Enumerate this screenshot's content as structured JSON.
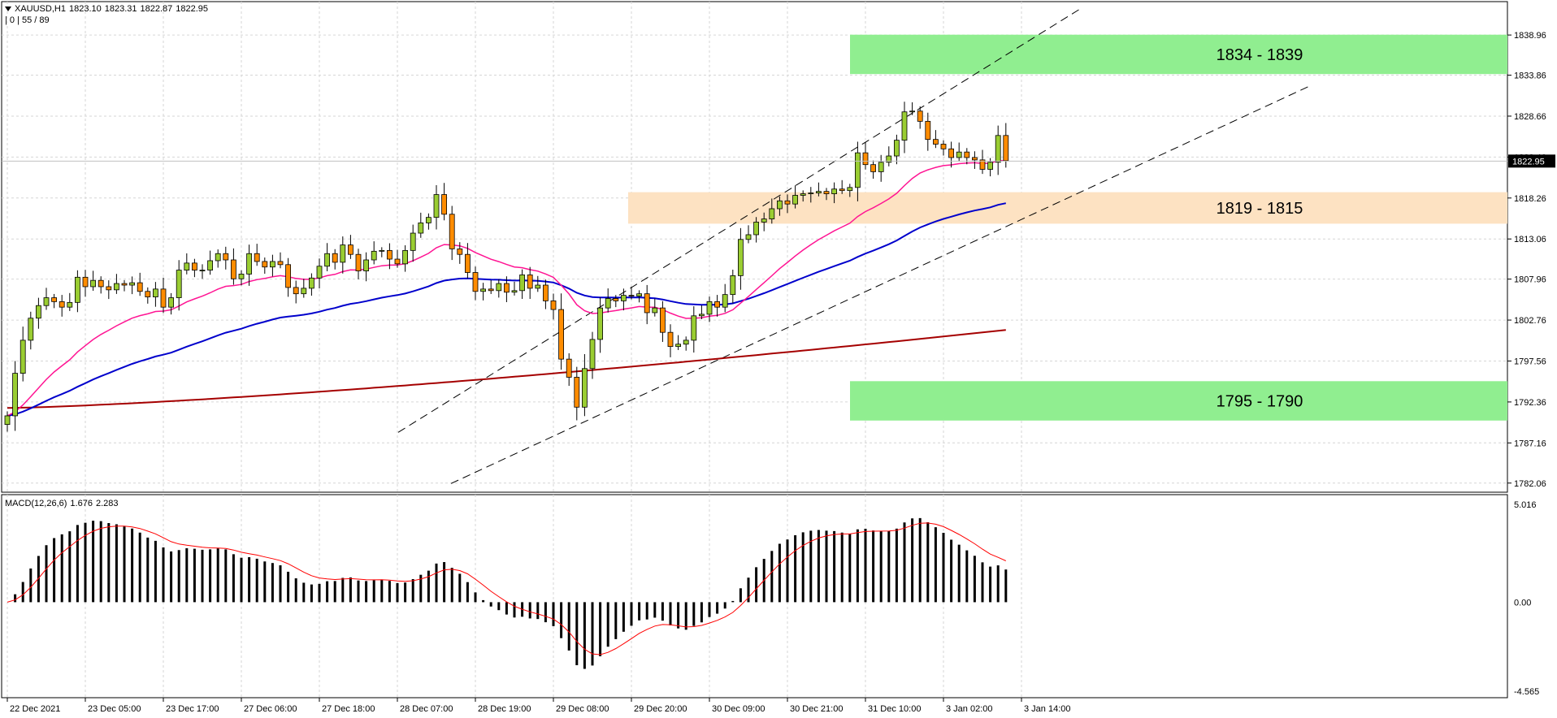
{
  "header": {
    "symbol": "XAUUSD,H1",
    "o": "1823.10",
    "h": "1823.31",
    "l": "1822.87",
    "c": "1822.95",
    "info": "| 0 | 55 / 89"
  },
  "macd_header": {
    "label": "MACD(12,26,6)",
    "v1": "1.676",
    "v2": "2.283"
  },
  "chart_data": [
    {
      "type": "candlestick",
      "series": [
        {
          "name": "",
          "color": "#ff1493"
        },
        {
          "name": "",
          "color": "#0000cc"
        },
        {
          "name": "",
          "color": "#a50000"
        }
      ],
      "price_axis": {
        "ticks": [
          "1838.96",
          "1833.86",
          "1828.66",
          "1823.46",
          "1818.26",
          "1813.06",
          "1807.96",
          "1802.76",
          "1797.56",
          "1792.36",
          "1787.16",
          "1782.06"
        ],
        "current": "1822.95",
        "ylim": [
          1780.9,
          1843.2
        ]
      },
      "time_axis": [
        "22 Dec 2021",
        "23 Dec 05:00",
        "23 Dec 17:00",
        "27 Dec 06:00",
        "27 Dec 18:00",
        "28 Dec 07:00",
        "28 Dec 19:00",
        "29 Dec 08:00",
        "29 Dec 20:00",
        "30 Dec 09:00",
        "30 Dec 21:00",
        "31 Dec 10:00",
        "3 Jan 02:00",
        "3 Jan 14:00"
      ],
      "zones": [
        {
          "label": "1834 - 1839",
          "from": 1834,
          "to": 1839,
          "color": "#90ee90"
        },
        {
          "label": "1819 - 1815",
          "from": 1815,
          "to": 1819,
          "color": "#fde2c2"
        },
        {
          "label": "1795 - 1790",
          "from": 1790,
          "to": 1795,
          "color": "#90ee90"
        }
      ],
      "close": [
        1790.6,
        1796,
        1800.2,
        1803,
        1804.6,
        1805.6,
        1805.1,
        1804.4,
        1805,
        1808.2,
        1807,
        1807.8,
        1807,
        1806.6,
        1807.4,
        1807.2,
        1807.5,
        1806.4,
        1805.7,
        1806.7,
        1804.4,
        1805.6,
        1809.1,
        1810,
        1809.1,
        1809.1,
        1810.3,
        1811.2,
        1810.4,
        1808,
        1808.6,
        1811.2,
        1810.2,
        1809.5,
        1810.2,
        1809.8,
        1806.9,
        1806.1,
        1806.8,
        1808.1,
        1809.6,
        1811.2,
        1810.1,
        1812.3,
        1811.1,
        1809,
        1810.4,
        1811.5,
        1811.6,
        1810.5,
        1809.9,
        1811.6,
        1813.8,
        1815.1,
        1815.8,
        1818.7,
        1816.2,
        1811.8,
        1811.1,
        1808.8,
        1806.4,
        1806.7,
        1806.5,
        1807.4,
        1806.3,
        1806.5,
        1808.5,
        1806.8,
        1807.2,
        1805.2,
        1804.1,
        1797.8,
        1795.5,
        1791.7,
        1796.6,
        1800.3,
        1804.3,
        1805.5,
        1805.2,
        1805.9,
        1805.8,
        1806.1,
        1803.7,
        1804.3,
        1801.2,
        1799.4,
        1799.7,
        1800.2,
        1803.3,
        1803.5,
        1805.1,
        1804.4,
        1806,
        1808.4,
        1813,
        1813.6,
        1815.2,
        1815.6,
        1816.9,
        1817.9,
        1817.5,
        1818.6,
        1818.8,
        1818.9,
        1819.1,
        1818.8,
        1819.4,
        1819.2,
        1819.6,
        1824,
        1822.5,
        1821.6,
        1822.8,
        1823.6,
        1825.6,
        1829.2,
        1829.3,
        1828,
        1825.7,
        1825.1,
        1824.5,
        1823.4,
        1824.1,
        1823.4,
        1823.1,
        1821.9,
        1822.8,
        1826.2,
        1823
      ],
      "ma_pink_last": 1823.5,
      "ma_blue_last": 1812,
      "ma_red_last": 1801.5
    },
    {
      "type": "bar",
      "title": "MACD(12,26,6)",
      "ylim": [
        -4.565,
        5.016
      ],
      "ticks": [
        "5.016",
        "0.00",
        "-4.565"
      ],
      "macd_last": 1.676,
      "signal_last": 2.283
    }
  ]
}
